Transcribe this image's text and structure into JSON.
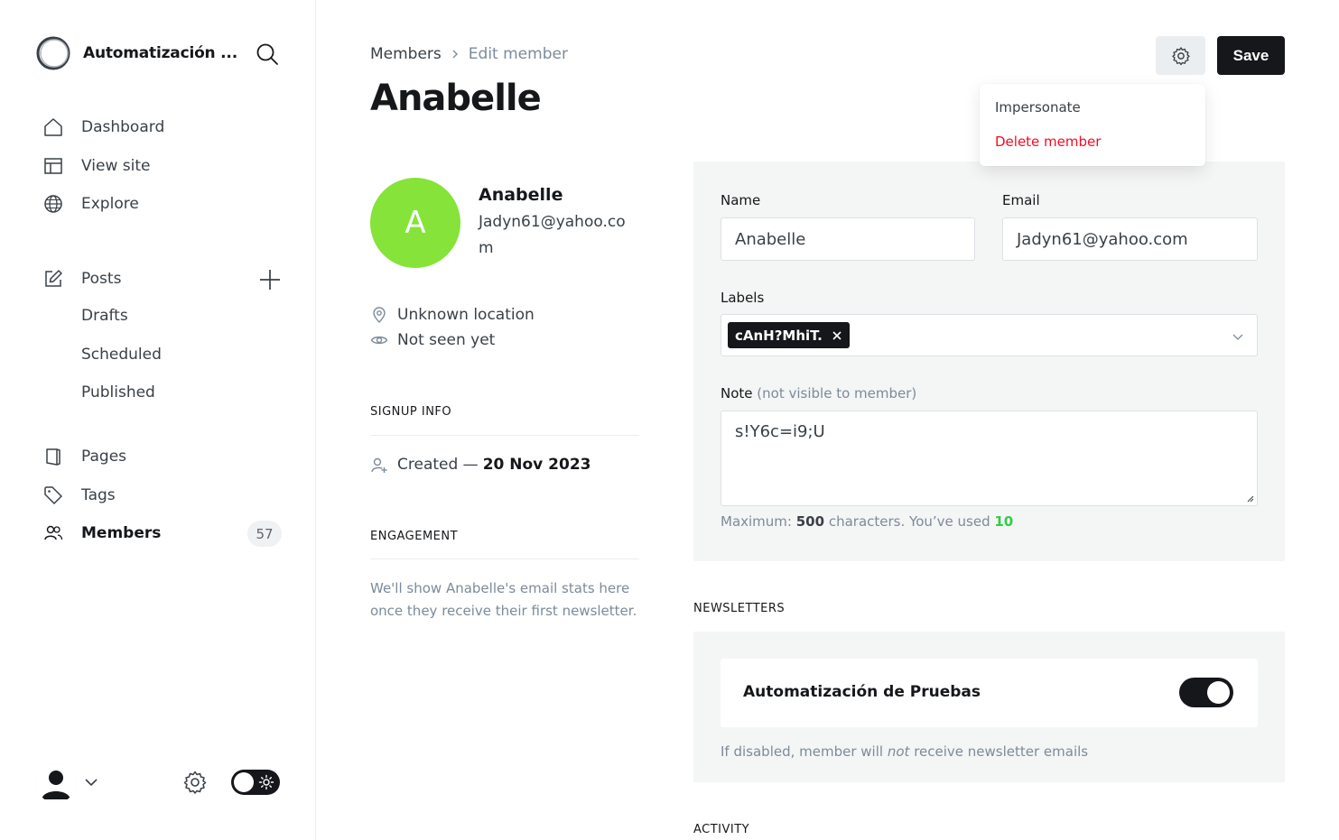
{
  "sidebar": {
    "brand_title": "Automatización ...",
    "items": [
      {
        "label": "Dashboard",
        "icon": "home-icon"
      },
      {
        "label": "View site",
        "icon": "layout-icon"
      },
      {
        "label": "Explore",
        "icon": "globe-icon"
      },
      {
        "label": "Posts",
        "icon": "edit-icon"
      },
      {
        "label": "Drafts"
      },
      {
        "label": "Scheduled"
      },
      {
        "label": "Published"
      },
      {
        "label": "Pages",
        "icon": "page-icon"
      },
      {
        "label": "Tags",
        "icon": "tag-icon"
      },
      {
        "label": "Members",
        "icon": "members-icon",
        "count": "57",
        "active": true
      }
    ]
  },
  "breadcrumb": {
    "parent": "Members",
    "current": "Edit member"
  },
  "page_title": "Anabelle",
  "actions": {
    "save_label": "Save"
  },
  "dropdown": {
    "impersonate": "Impersonate",
    "delete": "Delete member",
    "delete_color": "#f50b23"
  },
  "member": {
    "initial": "A",
    "avatar_color": "#85e33a",
    "name": "Anabelle",
    "email": "Jadyn61@yahoo.com",
    "location": "Unknown location",
    "seen": "Not seen yet"
  },
  "signup": {
    "heading": "SIGNUP INFO",
    "created_prefix": "Created —",
    "created_date": "20 Nov 2023"
  },
  "engagement": {
    "heading": "ENGAGEMENT",
    "text": "We'll show Anabelle's email stats here once they receive their first newsletter."
  },
  "form": {
    "name_label": "Name",
    "name_value": "Anabelle",
    "email_label": "Email",
    "email_value": "Jadyn61@yahoo.com",
    "labels_label": "Labels",
    "label_tokens": [
      "cAnH?MhiT."
    ],
    "note_label": "Note",
    "note_hint": "(not visible to member)",
    "note_value": "s!Y6c=i9;U",
    "max_prefix": "Maximum:",
    "max_value": "500",
    "max_mid": "characters. You’ve used",
    "used_value": "10",
    "used_color": "#30cf43"
  },
  "newsletters": {
    "heading": "NEWSLETTERS",
    "item_name": "Automatización de Pruebas",
    "subscribed": true,
    "help_prefix": "If disabled, member will",
    "help_em": "not",
    "help_suffix": "receive newsletter emails"
  },
  "activity": {
    "heading": "ACTIVITY"
  }
}
